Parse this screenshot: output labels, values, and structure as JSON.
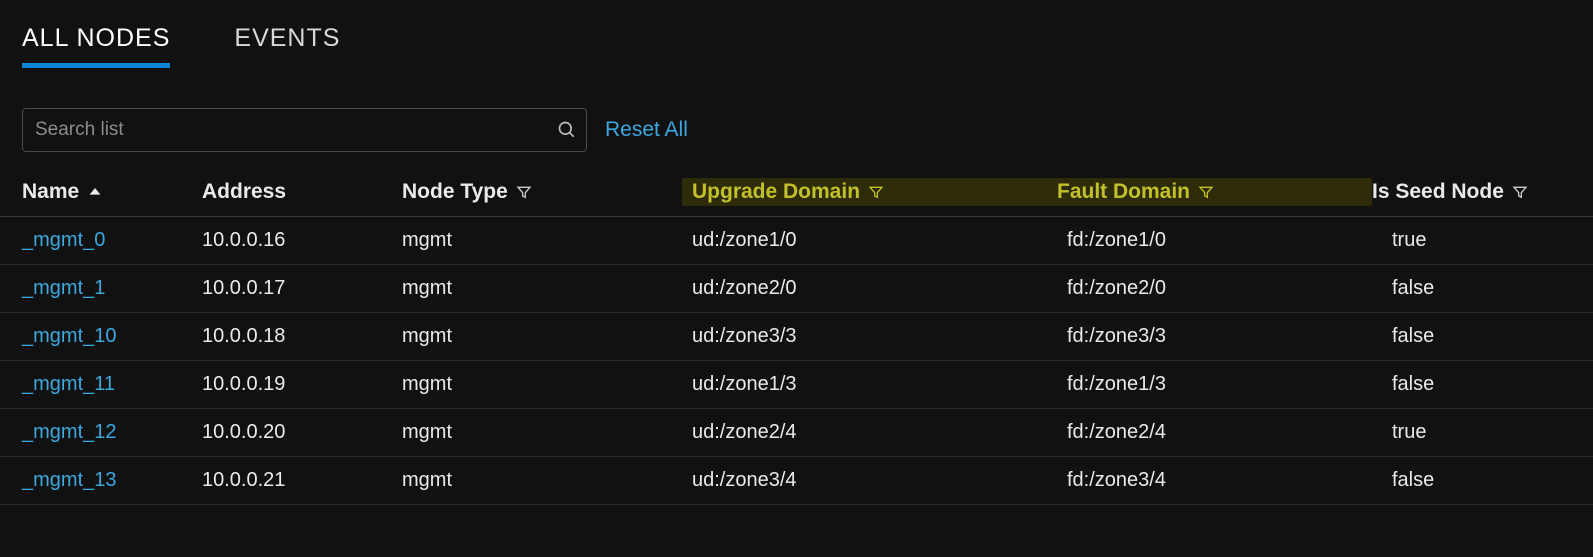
{
  "tabs": {
    "all_nodes": "ALL NODES",
    "events": "EVENTS"
  },
  "search": {
    "placeholder": "Search list",
    "value": ""
  },
  "reset_label": "Reset All",
  "columns": {
    "name": "Name",
    "address": "Address",
    "node_type": "Node Type",
    "upgrade_domain": "Upgrade Domain",
    "fault_domain": "Fault Domain",
    "is_seed": "Is Seed Node"
  },
  "rows": [
    {
      "name": "_mgmt_0",
      "address": "10.0.0.16",
      "type": "mgmt",
      "ud": "ud:/zone1/0",
      "fd": "fd:/zone1/0",
      "seed": "true"
    },
    {
      "name": "_mgmt_1",
      "address": "10.0.0.17",
      "type": "mgmt",
      "ud": "ud:/zone2/0",
      "fd": "fd:/zone2/0",
      "seed": "false"
    },
    {
      "name": "_mgmt_10",
      "address": "10.0.0.18",
      "type": "mgmt",
      "ud": "ud:/zone3/3",
      "fd": "fd:/zone3/3",
      "seed": "false"
    },
    {
      "name": "_mgmt_11",
      "address": "10.0.0.19",
      "type": "mgmt",
      "ud": "ud:/zone1/3",
      "fd": "fd:/zone1/3",
      "seed": "false"
    },
    {
      "name": "_mgmt_12",
      "address": "10.0.0.20",
      "type": "mgmt",
      "ud": "ud:/zone2/4",
      "fd": "fd:/zone2/4",
      "seed": "true"
    },
    {
      "name": "_mgmt_13",
      "address": "10.0.0.21",
      "type": "mgmt",
      "ud": "ud:/zone3/4",
      "fd": "fd:/zone3/4",
      "seed": "false"
    }
  ]
}
